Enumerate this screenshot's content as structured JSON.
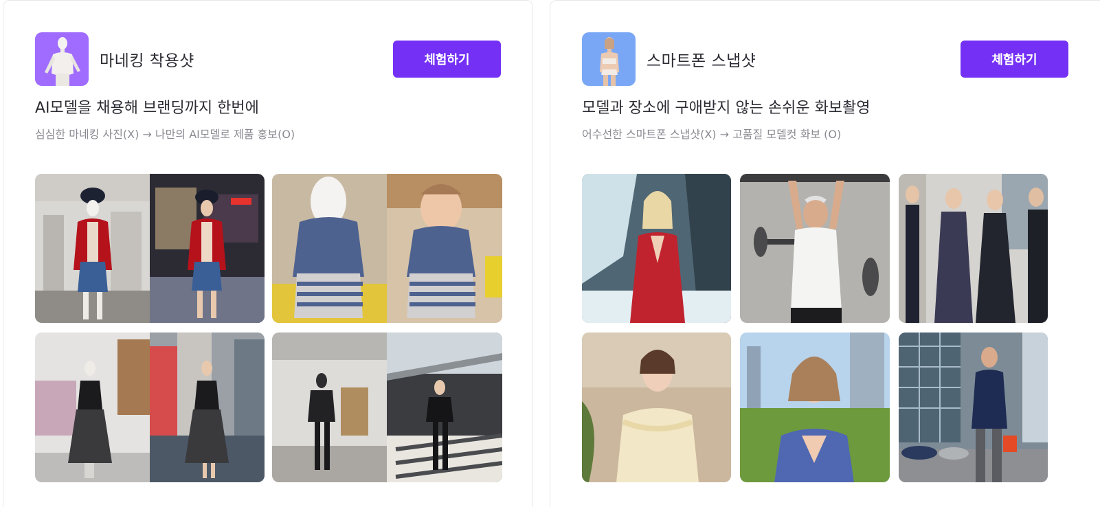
{
  "cards": [
    {
      "title": "마네킹 착용샷",
      "button_label": "체험하기",
      "headline": "AI모델을 채용해 브랜딩까지 한번에",
      "subline": "심심한 마네킹 사진(X) → 나만의 AI모델로 제품 홍보(O)",
      "thumb_color": "#9f6cff",
      "photos": [
        {
          "name": "mannequin-red-cardigan-office-photo"
        },
        {
          "name": "baby-knit-cardigan-photo"
        },
        {
          "name": "mannequin-black-dress-street-photo"
        },
        {
          "name": "mannequin-black-hoodie-gym-photo"
        }
      ]
    },
    {
      "title": "스마트폰 스냅샷",
      "button_label": "체험하기",
      "headline": "모델과 장소에 구애받지 않는 손쉬운 화보촬영",
      "subline": "어수선한 스마트폰 스냅샷(X) → 고품질 모델컷 화보 (O)",
      "thumb_color": "#7aa7f5",
      "photos": [
        {
          "name": "woman-red-dress-ice-photo"
        },
        {
          "name": "senior-man-gym-photo"
        },
        {
          "name": "women-group-palace-photo"
        },
        {
          "name": "woman-ruffle-top-photo"
        },
        {
          "name": "woman-blue-dress-city-photo"
        },
        {
          "name": "man-navy-blazer-street-photo"
        }
      ]
    }
  ],
  "colors": {
    "accent": "#7430f5",
    "title_text": "#2b2b33",
    "sub_text": "#8a8a92",
    "card_border": "#e8e8ec"
  }
}
